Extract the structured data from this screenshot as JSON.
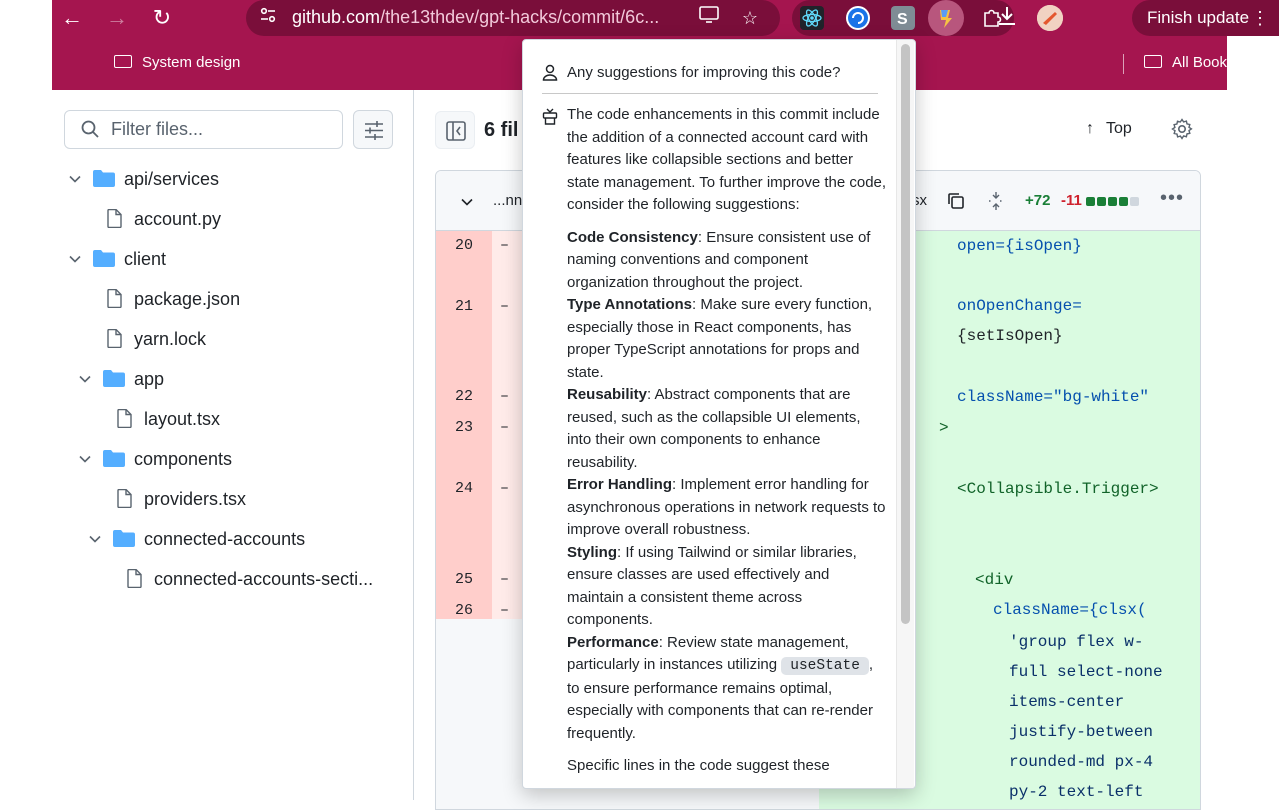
{
  "browser": {
    "url_host": "github.com",
    "url_path": "/the13thdev/gpt-hacks/commit/6c...",
    "finish_update_label": "Finish update",
    "bookmarks": {
      "system_design": "System design",
      "all_bookmarks": "All Bookmarks"
    }
  },
  "sidebar": {
    "filter_placeholder": "Filter files...",
    "tree": [
      {
        "label": "api/services",
        "type": "folder"
      },
      {
        "label": "account.py",
        "type": "file"
      },
      {
        "label": "client",
        "type": "folder"
      },
      {
        "label": "package.json",
        "type": "file"
      },
      {
        "label": "yarn.lock",
        "type": "file"
      },
      {
        "label": "app",
        "type": "folder"
      },
      {
        "label": "layout.tsx",
        "type": "file"
      },
      {
        "label": "components",
        "type": "folder"
      },
      {
        "label": "providers.tsx",
        "type": "file"
      },
      {
        "label": "connected-accounts",
        "type": "folder"
      },
      {
        "label": "connected-accounts-secti...",
        "type": "file"
      }
    ]
  },
  "header": {
    "files_count": "6 fil",
    "top_label": "Top"
  },
  "diff": {
    "file_name_fragment": "...nn",
    "file_ext_fragment": "sx",
    "additions": "+72",
    "deletions": "-11",
    "left_lines": [
      {
        "num": "20",
        "mark": "–"
      },
      {
        "num": "21",
        "mark": "–"
      },
      {
        "num": "22",
        "mark": "–"
      },
      {
        "num": "23",
        "mark": "–"
      },
      {
        "num": "24",
        "mark": "–"
      },
      {
        "num": "25",
        "mark": "–"
      },
      {
        "num": "26",
        "mark": "–"
      }
    ],
    "right_code": [
      "open={isOpen}",
      "onOpenChange=",
      "{setIsOpen}",
      "className=\"bg-white\"",
      ">",
      "<Collapsible.Trigger>",
      "<div",
      "className={clsx(",
      "'group flex w-",
      "full select-none",
      "items-center",
      "justify-between",
      "rounded-md px-4",
      "py-2 text-left"
    ],
    "colors": {
      "added": "#dafbe1",
      "deleted": "#ffebe9",
      "deleted_num": "#ffcecb",
      "add_text": "#1a7f37",
      "del_text": "#cf222e"
    }
  },
  "popup": {
    "question": "Any suggestions for improving this code?",
    "intro": "The code enhancements in this commit include the addition of a connected account card with features like collapsible sections and better state management. To further improve the code, consider the following suggestions:",
    "items": [
      {
        "title": "Code Consistency",
        "text": ": Ensure consistent use of naming conventions and component organization throughout the project."
      },
      {
        "title": "Type Annotations",
        "text": ": Make sure every function, especially those in React components, has proper TypeScript annotations for props and state."
      },
      {
        "title": "Reusability",
        "text": ": Abstract components that are reused, such as the collapsible UI elements, into their own components to enhance reusability."
      },
      {
        "title": "Error Handling",
        "text": ": Implement error handling for asynchronous operations in network requests to improve overall robustness."
      },
      {
        "title": "Styling",
        "text": ": If using Tailwind or similar libraries, ensure classes are used effectively and maintain a consistent theme across components."
      }
    ],
    "perf_title": "Performance",
    "perf_text_1": ": Review state management, particularly in instances utilizing",
    "perf_code": "useState",
    "perf_text_2": ", to ensure performance remains optimal, especially with components that can re-render frequently.",
    "trailing": "Specific lines in the code suggest these"
  },
  "colors": {
    "chrome": "#a5154f",
    "chrome_dark": "#7a0e3a",
    "folder": "#54aeff"
  }
}
